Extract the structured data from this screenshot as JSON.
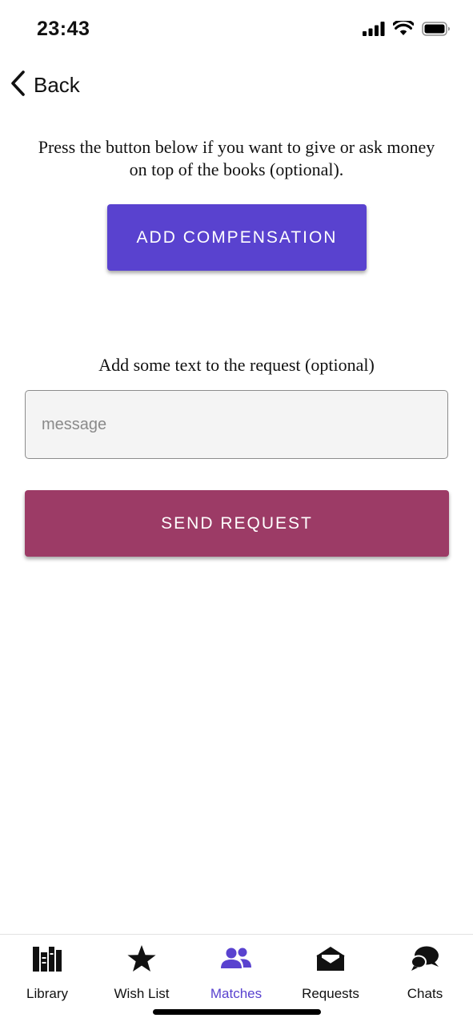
{
  "status_bar": {
    "time": "23:43"
  },
  "nav": {
    "back_label": "Back"
  },
  "compensation": {
    "info_text": "Press the button below if you want to give or ask money on top of the books (optional).",
    "button_label": "ADD COMPENSATION",
    "button_color": "#5942cf"
  },
  "request": {
    "label": "Add some text to the request (optional)",
    "message_placeholder": "message",
    "message_value": "",
    "send_label": "SEND REQUEST",
    "send_color": "#9c3b66"
  },
  "tab_bar": {
    "active": "Matches",
    "active_color": "#5942cf",
    "tabs": [
      {
        "label": "Library",
        "icon": "books-icon"
      },
      {
        "label": "Wish List",
        "icon": "star-icon"
      },
      {
        "label": "Matches",
        "icon": "users-icon"
      },
      {
        "label": "Requests",
        "icon": "envelope-open-icon"
      },
      {
        "label": "Chats",
        "icon": "chat-bubbles-icon"
      }
    ]
  }
}
